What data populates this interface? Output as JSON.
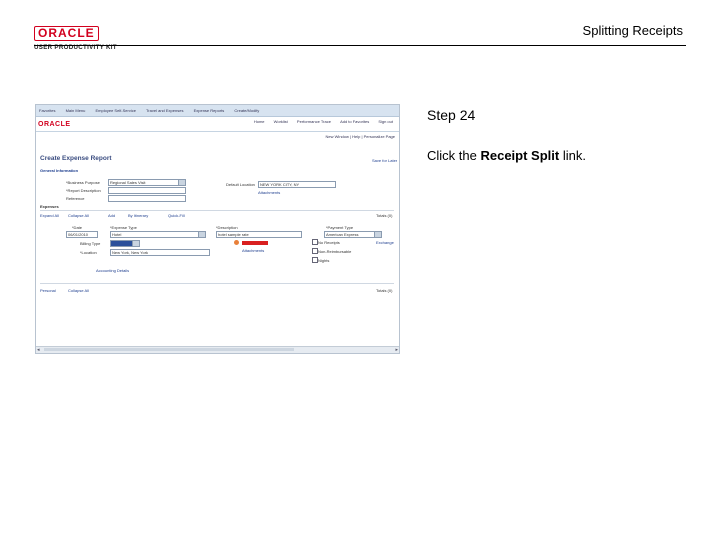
{
  "header": {
    "logo_oracle": "ORACLE",
    "logo_product": "USER PRODUCTIVITY KIT",
    "title": "Splitting Receipts"
  },
  "screenshot": {
    "nav_items": [
      "Favorites",
      "Main Menu",
      "Employee Self-Service",
      "Travel and Expenses",
      "Expense Reports",
      "Create/Modify"
    ],
    "top_links": [
      "Home",
      "Worklist",
      "Performance Trace",
      "Add to Favorites",
      "Sign out"
    ],
    "brand": "ORACLE",
    "new_window": "New Window | Help | Personalize Page",
    "page_title": "Create Expense Report",
    "links": {
      "general_info": "General Information",
      "save_for_later": "Save for Later",
      "expand_all": "Expand All",
      "collapse_all": "Collapse All",
      "add": "Add",
      "by_itinerary": "By Itinerary",
      "quick_fill": "Quick-Fill",
      "accounting_details": "Accounting Details",
      "personal": "Personal",
      "collapse_all2": "Collapse All",
      "receipt_split": "Receipt Split",
      "attachments": "Attachments"
    },
    "fields": {
      "business_purpose_label": "*Business Purpose",
      "business_purpose_value": "Regional Sales Visit",
      "report_description_label": "*Report Description",
      "reference_label": "Reference",
      "default_location_label": "Default Location",
      "default_location_value": "NEW YORK CITY, NY",
      "expenses_label": "Expenses",
      "date_label": "*Date",
      "date_value": "06/01/2010",
      "expense_type_label": "*Expense Type",
      "expense_type_value": "Hotel",
      "description_label": "*Description",
      "description_value": "hotel sample rate",
      "payment_type_label": "*Payment Type",
      "payment_type_value": "American Express",
      "billing_type_label": "Billing Type",
      "location_label": "*Location",
      "location_value": "New York, New York",
      "nights_label": "Nights",
      "amount_label": "*Amount",
      "no_receipt": "No Receipts",
      "non_reimbursable": "Non-Reimbursable",
      "exchange": "Exchange",
      "totals": "Totals (0)",
      "totals2": "Totals (0)"
    }
  },
  "instructions": {
    "step": "Step 24",
    "prefix": "Click the ",
    "bold": "Receipt Split",
    "suffix": " link."
  }
}
